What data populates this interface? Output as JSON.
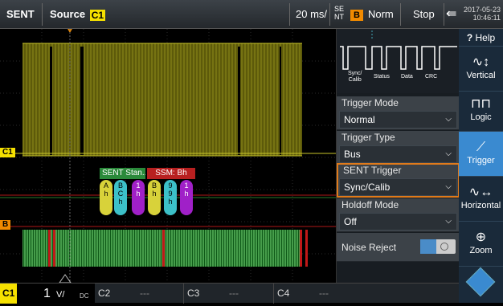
{
  "header": {
    "protocol": "SENT",
    "source_label": "Source",
    "source_channel": "C1",
    "timebase": "20 ms/",
    "trigger_src_top": "SE",
    "trigger_src_bottom": "NT",
    "trigger_badge": "B",
    "trigger_mode": "Norm",
    "run_state": "Stop",
    "date": "2017-05-23",
    "time": "10:46:11"
  },
  "waveform": {
    "c1_marker": "C1",
    "b_marker": "B",
    "frame_sent": "SENT Stan...",
    "frame_ssm": "SSM: Bh",
    "nibbles": [
      {
        "text": "A\nh",
        "color": "#d8d23a"
      },
      {
        "text": "B\nC\nh",
        "color": "#3cc0c8"
      },
      {
        "text": "1\nh",
        "color": "#a020c8"
      },
      {
        "text": "B\nh",
        "color": "#d8d23a"
      },
      {
        "text": "9\n9\nh",
        "color": "#3cc0c8"
      },
      {
        "text": "1\nh",
        "color": "#a020c8"
      }
    ]
  },
  "panel": {
    "diagram_labels": [
      "Sync/\nCalib",
      "Status",
      "Data",
      "CRC"
    ],
    "trigger_mode_title": "Trigger Mode",
    "trigger_mode_value": "Normal",
    "trigger_type_title": "Trigger Type",
    "trigger_type_value": "Bus",
    "sent_trigger_title": "SENT Trigger",
    "sent_trigger_value": "Sync/Calib",
    "holdoff_title": "Holdoff Mode",
    "holdoff_value": "Off",
    "noise_reject_label": "Noise Reject"
  },
  "rail": {
    "help": "Help",
    "vertical": "Vertical",
    "logic": "Logic",
    "trigger": "Trigger",
    "horizontal": "Horizontal",
    "zoom": "Zoom"
  },
  "bottom": {
    "c1": "C1",
    "c1_scale": "1",
    "c1_unit": "V/",
    "c1_coupling": "DC",
    "c2": "C2",
    "c2_val": "---",
    "c3": "C3",
    "c3_val": "---",
    "c4": "C4",
    "c4_val": "---"
  }
}
